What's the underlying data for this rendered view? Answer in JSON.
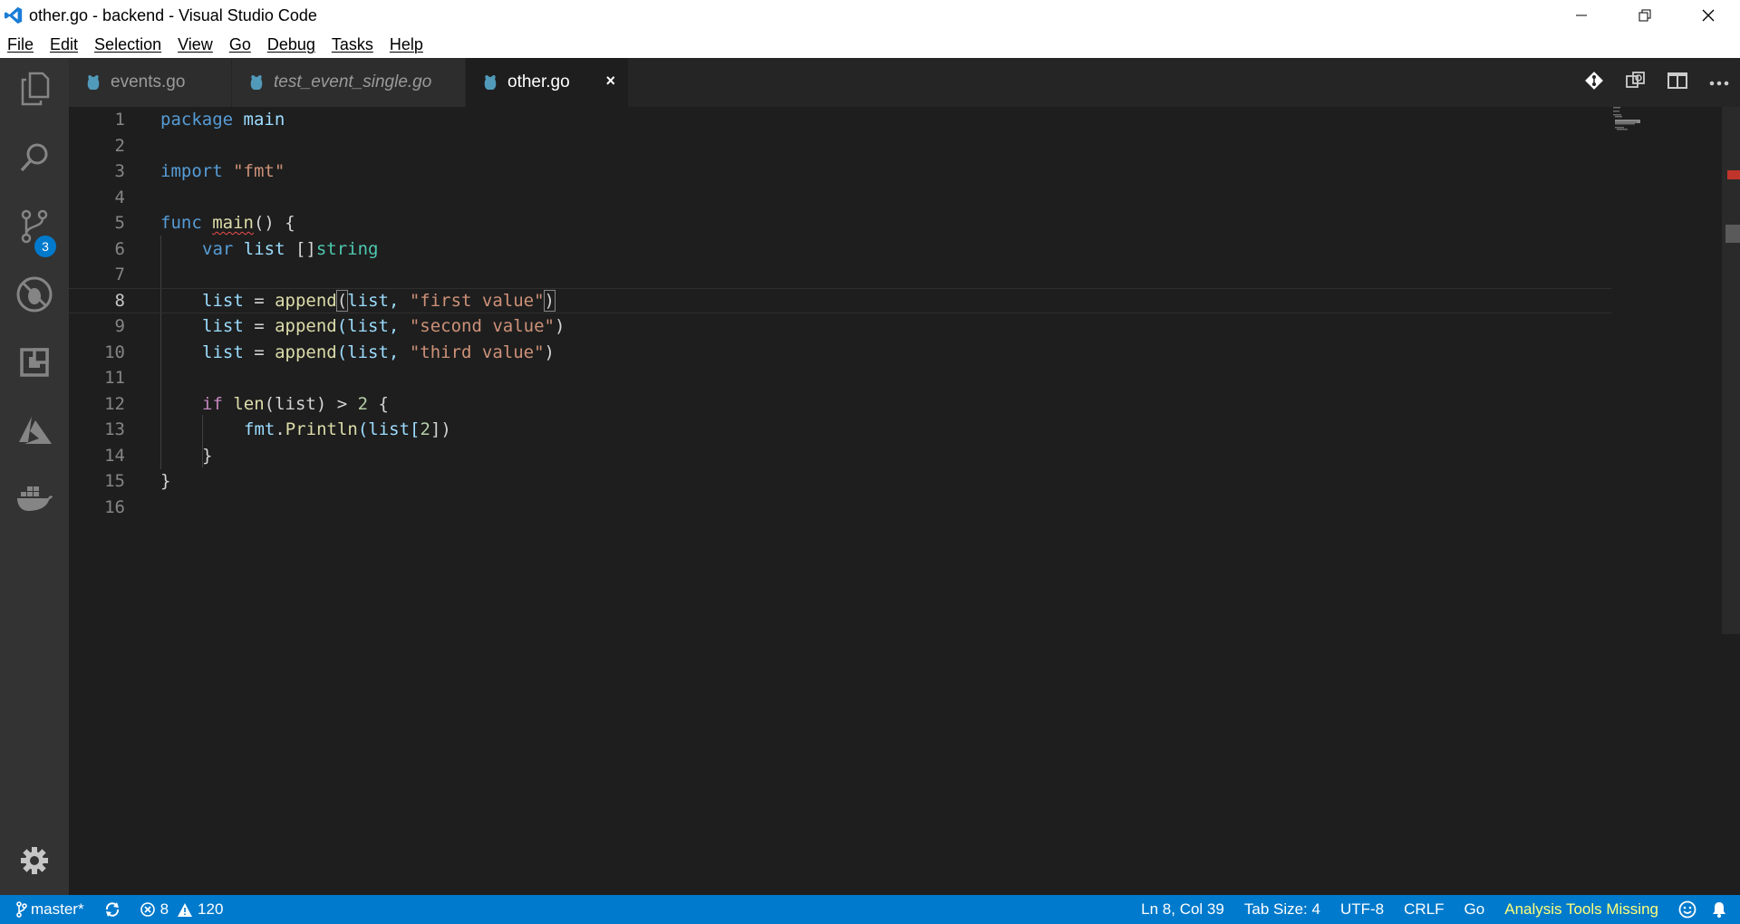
{
  "window": {
    "title": "other.go - backend - Visual Studio Code",
    "controls": [
      "minimize",
      "restore",
      "close"
    ]
  },
  "menu": [
    "File",
    "Edit",
    "Selection",
    "View",
    "Go",
    "Debug",
    "Tasks",
    "Help"
  ],
  "activitybar": {
    "items": [
      {
        "icon": "files-icon"
      },
      {
        "icon": "search-icon"
      },
      {
        "icon": "source-control-icon",
        "badge": "3"
      },
      {
        "icon": "debug-icon"
      },
      {
        "icon": "extensions-icon"
      },
      {
        "icon": "azure-icon"
      },
      {
        "icon": "docker-icon"
      }
    ],
    "settings_icon": "gear-icon"
  },
  "tabs": [
    {
      "label": "events.go",
      "active": false,
      "italic": false
    },
    {
      "label": "test_event_single.go",
      "active": false,
      "italic": true
    },
    {
      "label": "other.go",
      "active": true,
      "italic": false,
      "close": "×"
    }
  ],
  "editor": {
    "current_line": 8,
    "line_numbers": [
      "1",
      "2",
      "3",
      "4",
      "5",
      "6",
      "7",
      "8",
      "9",
      "10",
      "11",
      "12",
      "13",
      "14",
      "15",
      "16"
    ],
    "lines": {
      "l1": {
        "kw": "package",
        "rest": " main"
      },
      "l3": {
        "kw": "import",
        "sp": " ",
        "str": "\"fmt\""
      },
      "l5": {
        "kw": "func",
        "sp": " ",
        "fn": "main",
        "rest": "() {"
      },
      "l6": {
        "kw": "var",
        "id": " list ",
        "br": "[]",
        "ty": "string"
      },
      "l8": {
        "a": "list",
        "b": " = ",
        "fn": "append",
        "open": "(",
        "c": "list, ",
        "str": "\"first value\"",
        "close": ")"
      },
      "l9": {
        "a": "list",
        "b": " = ",
        "fn": "append",
        "c": "(list, ",
        "str": "\"second value\"",
        "close": ")"
      },
      "l10": {
        "a": "list",
        "b": " = ",
        "fn": "append",
        "c": "(list, ",
        "str": "\"third value\"",
        "close": ")"
      },
      "l12": {
        "kw": "if",
        "fn": " len",
        "c": "(list) > ",
        "num": "2",
        "close": " {"
      },
      "l13": {
        "a": "fmt",
        "b": ".",
        "fn": "Println",
        "c": "(list[",
        "num": "2",
        "close": "])"
      },
      "l14": {
        "close": "}"
      },
      "l15": {
        "close": "}"
      }
    }
  },
  "statusbar": {
    "branch": "master*",
    "sync_icon": "sync-icon",
    "errors": "8",
    "warnings": "120",
    "position": "Ln 8, Col 39",
    "tab_size": "Tab Size: 4",
    "encoding": "UTF-8",
    "eol": "CRLF",
    "language": "Go",
    "analysis": "Analysis Tools Missing"
  },
  "colors": {
    "statusbar": "#007acc",
    "activitybar": "#333333",
    "editor_bg": "#1e1e1e",
    "keyword": "#569cd6",
    "string": "#ce9178",
    "function": "#dcdcaa",
    "type": "#4ec9b0"
  }
}
